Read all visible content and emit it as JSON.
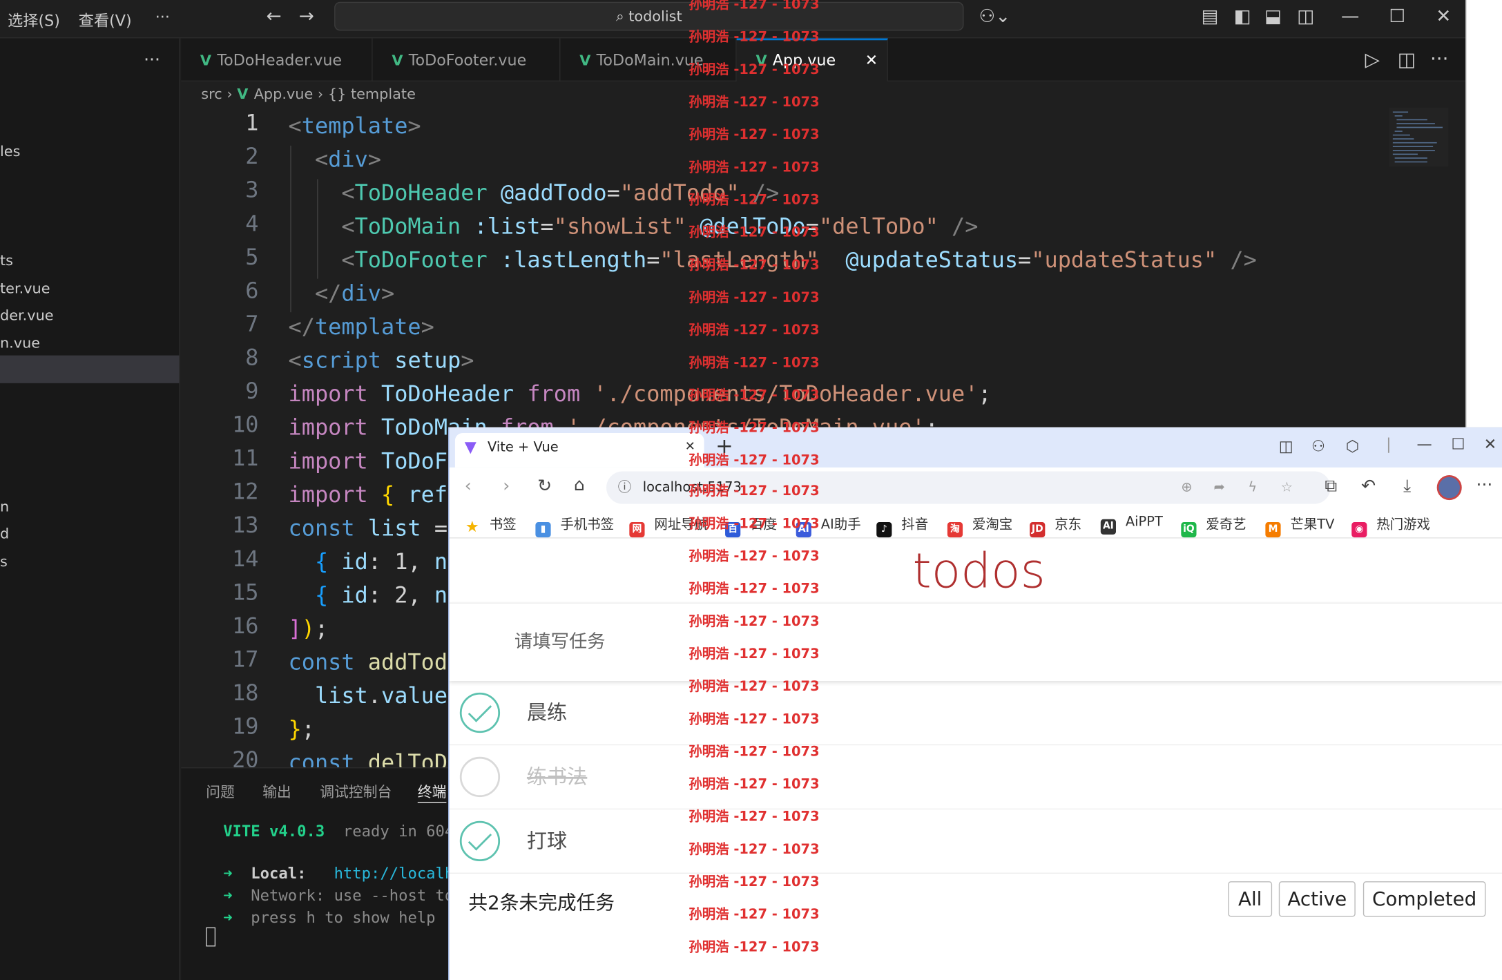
{
  "vscode": {
    "menu": [
      "选择(S)",
      "查看(V)",
      "···"
    ],
    "search_text": "todolist",
    "sidebar_files": [
      "les",
      "ts",
      "ter.vue",
      "der.vue",
      "n.vue",
      "n",
      "d",
      "s"
    ],
    "tabs": [
      "ToDoHeader.vue",
      "ToDoFooter.vue",
      "ToDoMain.vue",
      "App.vue"
    ],
    "active_tab": "App.vue",
    "breadcrumb": [
      "src",
      "App.vue",
      "{} template"
    ],
    "line_numbers": [
      "1",
      "2",
      "3",
      "4",
      "5",
      "6",
      "7",
      "8",
      "9",
      "10",
      "11",
      "12",
      "13",
      "14",
      "15",
      "16",
      "17",
      "18",
      "19",
      "20"
    ],
    "code_lines": [
      "<template>",
      "  <div>",
      "    <ToDoHeader @addTodo=\"addTodo\" />",
      "    <ToDoMain :list=\"showList\" @delToDo=\"delToDo\" />",
      "    <ToDoFooter :lastLength=\"lastLength\"  @updateStatus=\"updateStatus\" />",
      "  </div>",
      "</template>",
      "<script setup>",
      "import ToDoHeader from './components/ToDoHeader.vue';",
      "import ToDoMain from './components/ToDoMain.vue';",
      "import ToDoF",
      "import { ref",
      "const list =",
      "  { id: 1, n",
      "  { id: 2, n",
      "]);",
      "const addTod",
      "  list.value",
      "};",
      "const delToD"
    ],
    "panel_tabs": [
      "问题",
      "输出",
      "调试控制台",
      "终端"
    ],
    "active_panel_tab": "终端",
    "terminal": {
      "vite": "VITE v4.0.3",
      "ready": "ready in 604",
      "local_label": "Local:",
      "local_url": "http://localh",
      "network_label": "Network:",
      "network_text": "use --host to",
      "help_text": "press h to show help"
    }
  },
  "browser": {
    "tab_title": "Vite + Vue",
    "address": "localhost:5173",
    "bookmarks": [
      {
        "label": "书签",
        "color": "#f5b400",
        "glyph": "★"
      },
      {
        "label": "手机书签",
        "color": "#4a90e2",
        "glyph": "▮"
      },
      {
        "label": "网址导航",
        "color": "#e53935",
        "glyph": "网"
      },
      {
        "label": "百度",
        "color": "#2e5bd9",
        "glyph": "百"
      },
      {
        "label": "AI助手",
        "color": "#3b5bdb",
        "glyph": "AI"
      },
      {
        "label": "抖音",
        "color": "#111111",
        "glyph": "♪"
      },
      {
        "label": "爱淘宝",
        "color": "#e53935",
        "glyph": "淘"
      },
      {
        "label": "京东",
        "color": "#d32f2f",
        "glyph": "JD"
      },
      {
        "label": "AiPPT",
        "color": "#333333",
        "glyph": "AI"
      },
      {
        "label": "爱奇艺",
        "color": "#1fb74a",
        "glyph": "iQ"
      },
      {
        "label": "芒果TV",
        "color": "#f57c00",
        "glyph": "M"
      },
      {
        "label": "热门游戏",
        "color": "#e91e63",
        "glyph": "◉"
      }
    ]
  },
  "todo_app": {
    "title": "todos",
    "input_placeholder": "请填写任务",
    "items": [
      {
        "text": "晨练",
        "done": true
      },
      {
        "text": "练书法",
        "done": false
      },
      {
        "text": "打球",
        "done": true
      }
    ],
    "footer_prefix": "共",
    "footer_count": "2",
    "footer_suffix": "条未完成任务",
    "filters": [
      "All",
      "Active",
      "Completed"
    ]
  },
  "watermark": "孙明浩 -127 - 1073",
  "colors": {
    "vue_green": "#41b883",
    "todo_title": "#af2f2f",
    "check": "#5dc2af",
    "watermark": "#e03030"
  }
}
